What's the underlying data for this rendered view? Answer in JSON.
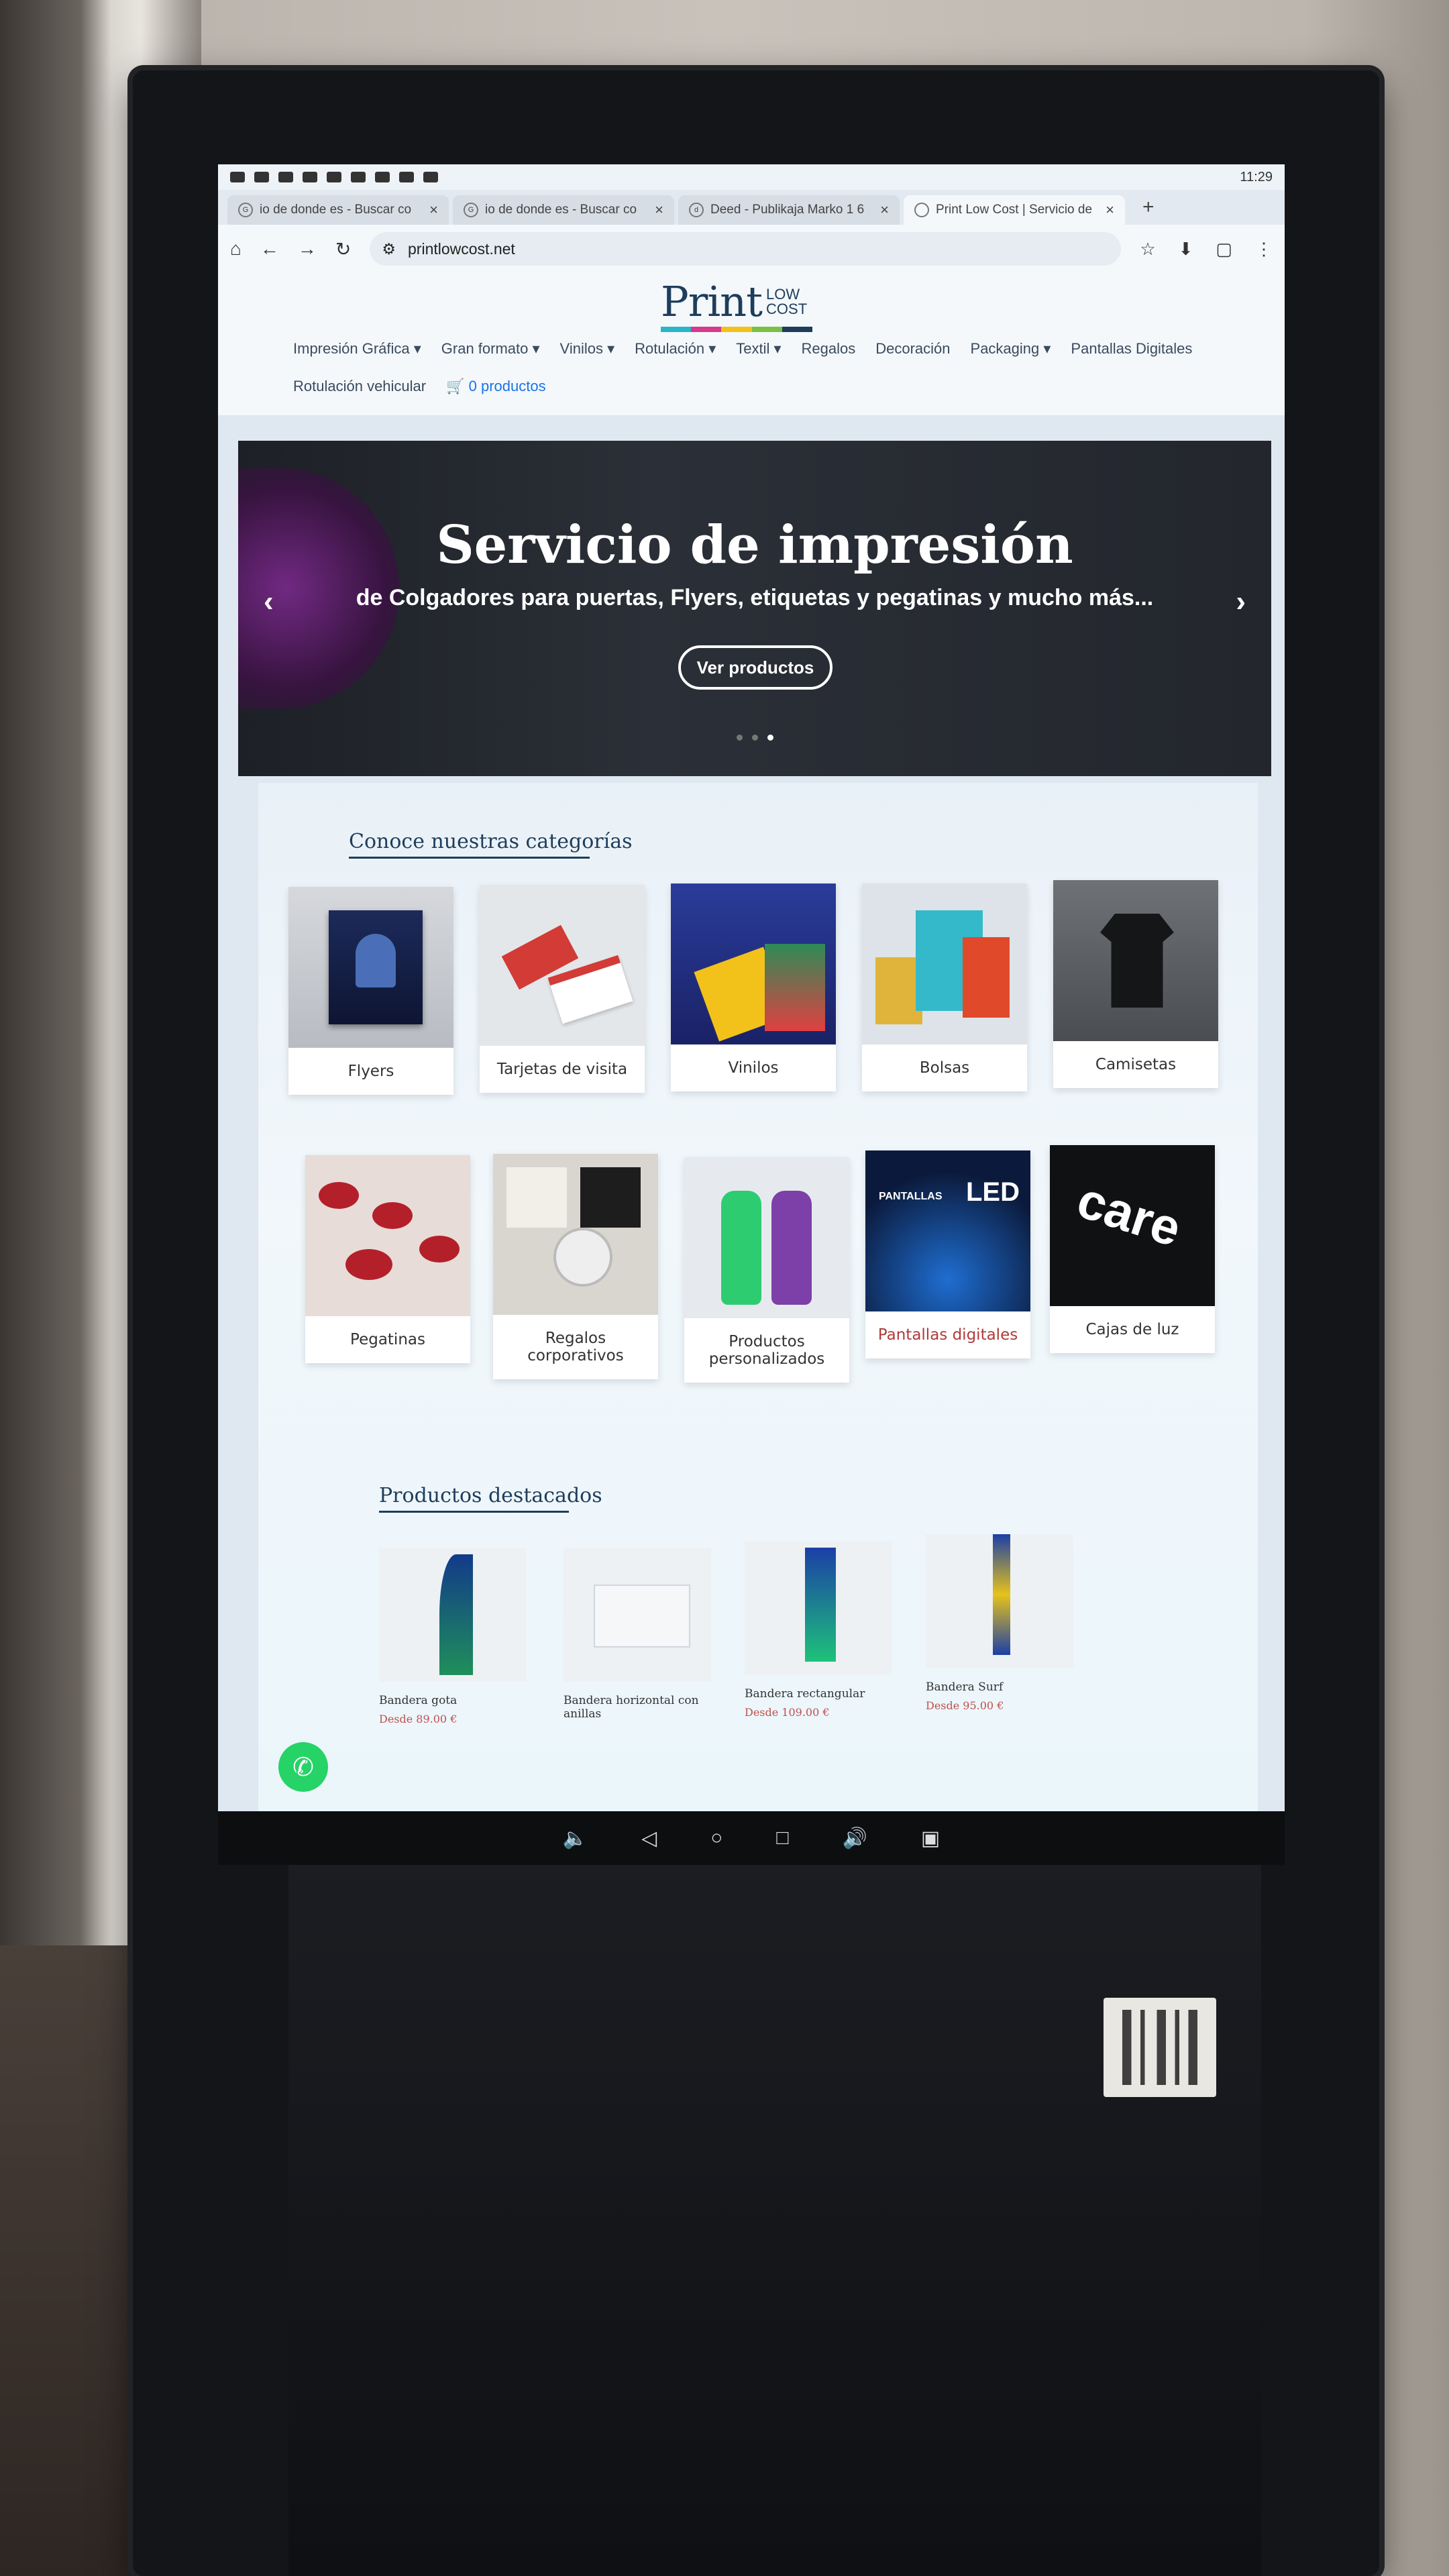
{
  "status_bar": {
    "time": "11:29"
  },
  "tabs": [
    {
      "label": "io de donde es - Buscar co"
    },
    {
      "label": "io de donde es - Buscar co"
    },
    {
      "label": "Deed - Publikaja Marko 1 6"
    },
    {
      "label": "Print Low Cost | Servicio de"
    }
  ],
  "address_bar": {
    "url": "printlowcost.net"
  },
  "logo": {
    "main": "Print",
    "low": "LOW",
    "cost": "COST"
  },
  "nav": {
    "items": [
      "Impresión Gráfica ▾",
      "Gran formato ▾",
      "Vinilos ▾",
      "Rotulación ▾",
      "Textil ▾",
      "Regalos",
      "Decoración",
      "Packaging ▾",
      "Pantallas Digitales",
      "Rotulación vehicular"
    ],
    "cart": "🛒 0 productos"
  },
  "hero": {
    "title": "Servicio de impresión",
    "subtitle": "de Colgadores para puertas, Flyers, etiquetas y pegatinas y mucho más...",
    "button": "Ver productos"
  },
  "categories": {
    "title": "Conoce nuestras categorías",
    "items": [
      "Flyers",
      "Tarjetas de visita",
      "Vinilos",
      "Bolsas",
      "Camisetas",
      "Pegatinas",
      "Regalos corporativos",
      "Productos personalizados",
      "Pantallas digitales",
      "Cajas de luz"
    ]
  },
  "products": {
    "title": "Productos destacados",
    "items": [
      {
        "name": "Bandera gota",
        "price": "Desde 89.00 €"
      },
      {
        "name": "Bandera horizontal con anillas",
        "price": ""
      },
      {
        "name": "Bandera rectangular",
        "price": "Desde 109.00 €"
      },
      {
        "name": "Bandera Surf",
        "price": "Desde 95.00 €"
      }
    ]
  },
  "image_text": {
    "pantallas": "PANTALLAS",
    "led": "LED",
    "care": "care"
  },
  "colors": {
    "accent": "#1f3d5b",
    "price": "#c0504d",
    "whatsapp": "#25d366"
  }
}
